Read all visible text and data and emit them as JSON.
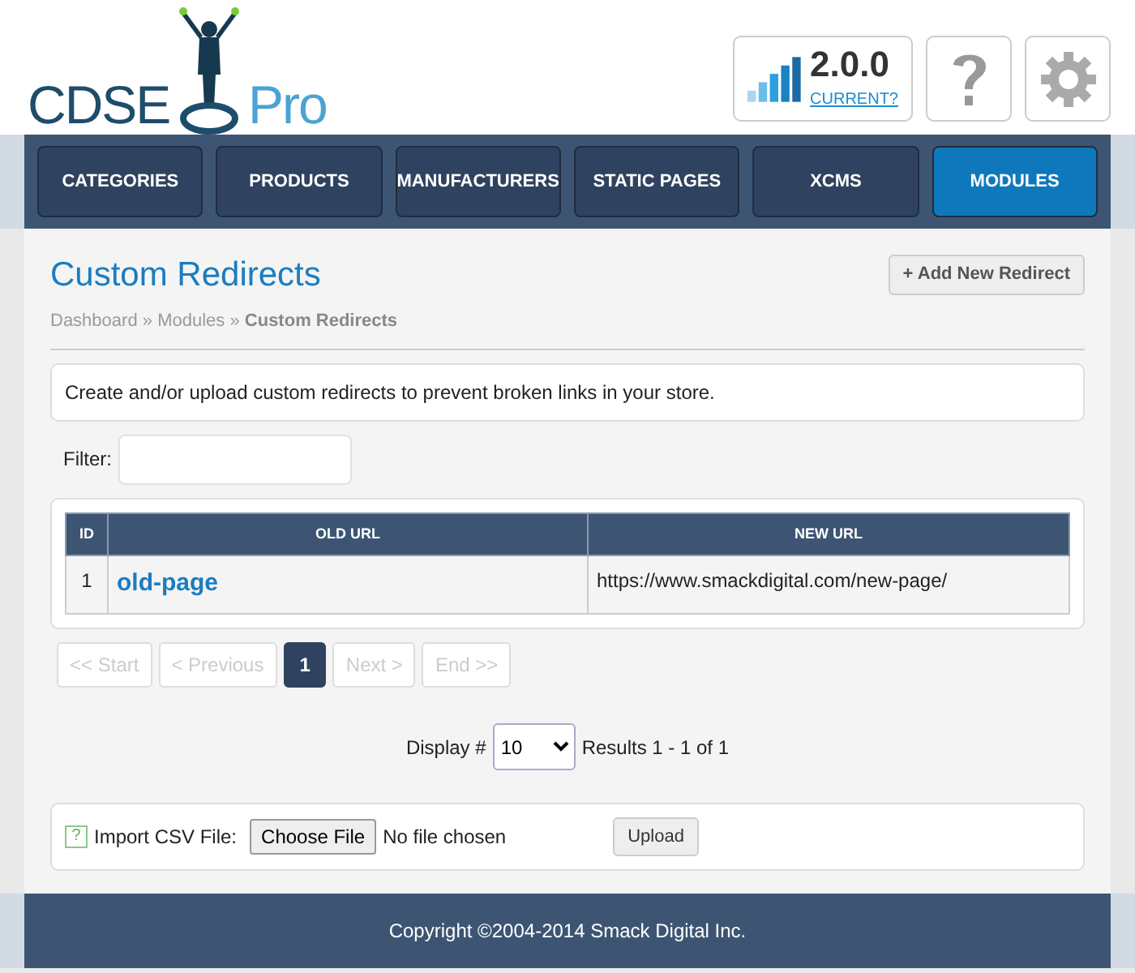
{
  "header": {
    "logo": {
      "left": "CDSE",
      "right": "Pro"
    },
    "version": "2.0.0",
    "version_link": "CURRENT?"
  },
  "nav": [
    {
      "label": "CATEGORIES",
      "selected": false
    },
    {
      "label": "PRODUCTS",
      "selected": false
    },
    {
      "label": "MANUFACTURERS",
      "selected": false
    },
    {
      "label": "STATIC PAGES",
      "selected": false
    },
    {
      "label": "XCMS",
      "selected": false
    },
    {
      "label": "MODULES",
      "selected": true
    }
  ],
  "page_title": "Custom Redirects",
  "add_button": "+ Add New Redirect",
  "breadcrumb": [
    {
      "label": "Dashboard",
      "current": false
    },
    {
      "label": "Modules",
      "current": false
    },
    {
      "label": "Custom Redirects",
      "current": true
    }
  ],
  "breadcrumb_separator": "»",
  "intro": "Create and/or upload custom redirects to prevent broken links in your store.",
  "filter": {
    "label": "Filter:"
  },
  "table": {
    "columns": [
      "ID",
      "OLD URL",
      "NEW URL"
    ],
    "rows": [
      {
        "id": "1",
        "old_url": "old-page",
        "new_url": "https://www.smackdigital.com/new-page/"
      }
    ]
  },
  "pagination": [
    {
      "label": "<< Start",
      "disabled": true,
      "selected": false
    },
    {
      "label": "< Previous",
      "disabled": true,
      "selected": false
    },
    {
      "label": "1",
      "disabled": false,
      "selected": true
    },
    {
      "label": "Next >",
      "disabled": true,
      "selected": false
    },
    {
      "label": "End >>",
      "disabled": true,
      "selected": false
    }
  ],
  "display": {
    "label": "Display #",
    "value": "10",
    "results": "Results 1 - 1 of 1"
  },
  "import": {
    "help": "?",
    "label": "Import CSV File:",
    "choose": "Choose File",
    "file_status": "No file chosen",
    "upload": "Upload"
  },
  "footer": "Copyright ©2004-2014 Smack Digital Inc."
}
